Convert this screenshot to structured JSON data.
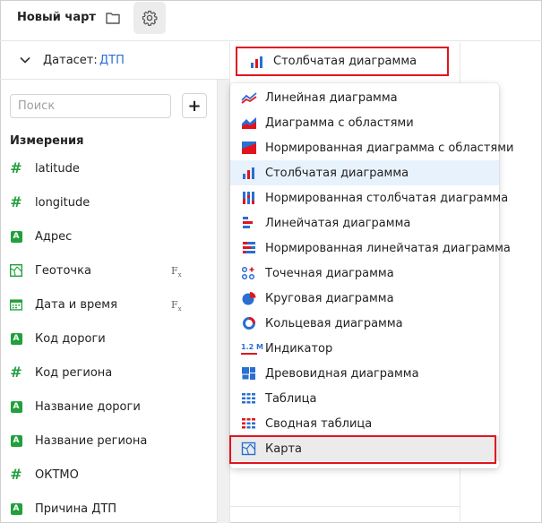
{
  "header": {
    "chart_title": "Новый чарт",
    "folder_icon": "folder-icon",
    "gear_icon": "gear-icon"
  },
  "dataset": {
    "label": "Датасет:",
    "name": "ДТП"
  },
  "search": {
    "placeholder": "Поиск",
    "value": ""
  },
  "add_button_label": "+",
  "dimensions_title": "Измерения",
  "fields": [
    {
      "label": "latitude",
      "icon": "number-icon",
      "fx": false
    },
    {
      "label": "longitude",
      "icon": "number-icon",
      "fx": false
    },
    {
      "label": "Адрес",
      "icon": "string-icon",
      "fx": false
    },
    {
      "label": "Геоточка",
      "icon": "geopoint-icon",
      "fx": true
    },
    {
      "label": "Дата и время",
      "icon": "datetime-icon",
      "fx": true
    },
    {
      "label": "Код дороги",
      "icon": "string-icon",
      "fx": false
    },
    {
      "label": "Код региона",
      "icon": "number-icon",
      "fx": false
    },
    {
      "label": "Название дороги",
      "icon": "string-icon",
      "fx": false
    },
    {
      "label": "Название региона",
      "icon": "string-icon",
      "fx": false
    },
    {
      "label": "ОКТМО",
      "icon": "number-icon",
      "fx": false
    },
    {
      "label": "Причина ДТП",
      "icon": "string-icon",
      "fx": false
    }
  ],
  "fx_label": "F",
  "fx_sub": "x",
  "string_badge": "A",
  "hash_glyph": "#",
  "selector_label": "Столбчатая диаграмма",
  "indicator_icon_text": "1.2 M",
  "chart_types": [
    {
      "label": "Линейная диаграмма",
      "icon": "line-chart-icon"
    },
    {
      "label": "Диаграмма с областями",
      "icon": "area-chart-icon"
    },
    {
      "label": "Нормированная диаграмма с областями",
      "icon": "normalized-area-chart-icon"
    },
    {
      "label": "Столбчатая диаграмма",
      "icon": "column-chart-icon",
      "selected": true
    },
    {
      "label": "Нормированная столбчатая диаграмма",
      "icon": "normalized-column-chart-icon"
    },
    {
      "label": "Линейчатая диаграмма",
      "icon": "bar-chart-icon"
    },
    {
      "label": "Нормированная линейчатая диаграмма",
      "icon": "normalized-bar-chart-icon"
    },
    {
      "label": "Точечная диаграмма",
      "icon": "scatter-chart-icon"
    },
    {
      "label": "Круговая диаграмма",
      "icon": "pie-chart-icon"
    },
    {
      "label": "Кольцевая диаграмма",
      "icon": "donut-chart-icon"
    },
    {
      "label": "Индикатор",
      "icon": "indicator-icon"
    },
    {
      "label": "Древовидная диаграмма",
      "icon": "treemap-icon"
    },
    {
      "label": "Таблица",
      "icon": "table-icon"
    },
    {
      "label": "Сводная таблица",
      "icon": "pivot-table-icon"
    },
    {
      "label": "Карта",
      "icon": "map-icon",
      "highlighted": true
    }
  ],
  "colors": {
    "accent_red": "#e1141e",
    "blue": "#2a6fd1",
    "green": "#21a03c"
  }
}
